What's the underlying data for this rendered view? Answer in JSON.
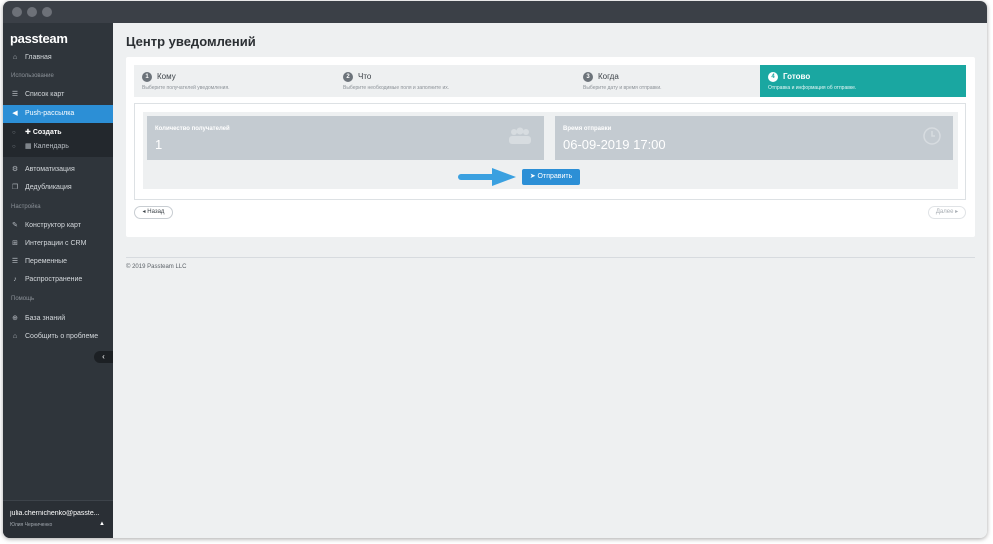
{
  "brand": {
    "logo": "passteam"
  },
  "sidebar": {
    "sections": [
      "Использование",
      "Настройка",
      "Помощь"
    ],
    "items": [
      {
        "label": "Главная",
        "icon": "home-icon"
      },
      {
        "label": "Список карт",
        "icon": "list-icon"
      },
      {
        "label": "Push-рассылка",
        "icon": "megaphone-icon"
      },
      {
        "label": "Автоматизация",
        "icon": "gear-icon"
      },
      {
        "label": "Дедубликация",
        "icon": "copy-icon"
      },
      {
        "label": "Конструктор карт",
        "icon": "brush-icon"
      },
      {
        "label": "Интеграции с CRM",
        "icon": "sitemap-icon"
      },
      {
        "label": "Переменные",
        "icon": "list-icon"
      },
      {
        "label": "Распространение",
        "icon": "bell-icon"
      },
      {
        "label": "База знаний",
        "icon": "lifebuoy-icon"
      },
      {
        "label": "Сообщить о проблеме",
        "icon": "bank-icon"
      }
    ],
    "subitems": [
      {
        "label": "Создать",
        "icon": "plus-icon"
      },
      {
        "label": "Календарь",
        "icon": "calendar-icon"
      }
    ],
    "collapse_glyph": "‹",
    "user": {
      "email": "julia.chernichenko@passte...",
      "name": "Юлия Черниченко",
      "caret": "▲"
    }
  },
  "main": {
    "title": "Центр уведомлений",
    "steps": [
      {
        "num": "1",
        "title": "Кому",
        "desc": "Выберите получателей уведомления."
      },
      {
        "num": "2",
        "title": "Что",
        "desc": "Выберите необходимые поля и заполните их."
      },
      {
        "num": "3",
        "title": "Когда",
        "desc": "Выберите дату и время отправки."
      },
      {
        "num": "4",
        "title": "Готово",
        "desc": "Отправка и информация об отправке."
      }
    ],
    "active_step": 4,
    "recipients": {
      "label": "Количество получателей",
      "value": "1",
      "icon": "users-icon"
    },
    "send_time": {
      "label": "Время отправки",
      "value": "06-09-2019 17:00",
      "icon": "clock-icon"
    },
    "send_button": "Отправить",
    "back_button": "Назад",
    "next_button": "Далее",
    "footer": "© 2019 Passteam LLC"
  },
  "colors": {
    "accent": "#2c8fd6",
    "teal": "#1aa7a1",
    "sidebar": "#2f353b"
  }
}
